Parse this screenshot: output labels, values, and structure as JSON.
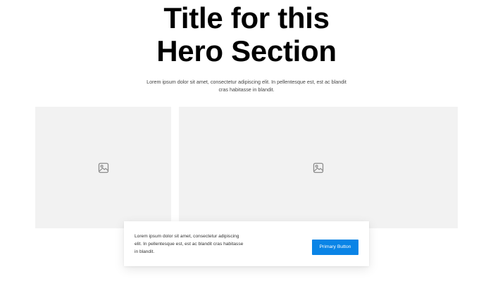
{
  "hero": {
    "title_line1": "Title for this",
    "title_line2": "Hero Section",
    "subtitle": "Lorem ipsum dolor sit amet, consectetur adipiscing elit. In pellentesque est, est ac blandit cras habitasse in blandit."
  },
  "images": [
    {
      "icon": "image-icon"
    },
    {
      "icon": "image-icon"
    }
  ],
  "cta": {
    "text": "Lorem ipsum dolor sit amet, consectetur adipiscing elit. In pellentesque est, est ac blandit cras habitasse in blandit.",
    "button_label": "Primary Button"
  },
  "colors": {
    "background": "#ffffff",
    "placeholder": "#f2f2f2",
    "icon": "#8c8c8c",
    "button": "#0a84e6",
    "title": "#000000"
  }
}
